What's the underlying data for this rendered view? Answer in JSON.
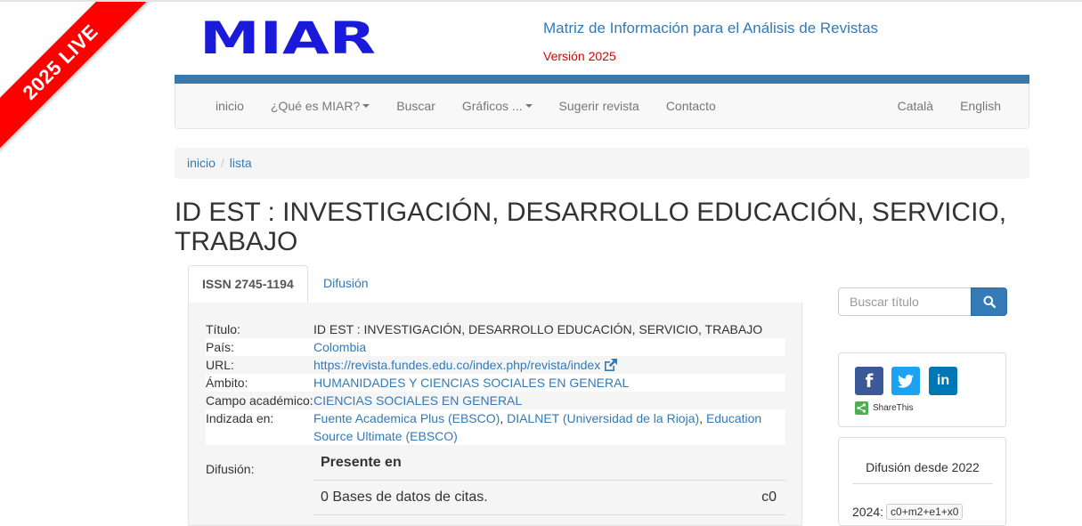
{
  "ribbon": {
    "text": "2025 LIVE"
  },
  "header": {
    "logo_text": "MIAR",
    "title": "Matriz de Información para el Análisis de Revistas",
    "version": "Versión 2025"
  },
  "nav": {
    "left": [
      "inicio",
      "¿Qué es MIAR?",
      "Buscar",
      "Gráficos ...",
      "Sugerir revista",
      "Contacto"
    ],
    "right": [
      "Català",
      "English"
    ]
  },
  "breadcrumb": [
    "inicio",
    "lista"
  ],
  "page_title": "ID EST : INVESTIGACIÓN, DESARROLLO EDUCACIÓN, SERVICIO, TRABAJO",
  "tabs": {
    "active": "ISSN 2745-1194",
    "other": "Difusión"
  },
  "details": {
    "titulo_label": "Título:",
    "titulo_value": "ID EST : INVESTIGACIÓN, DESARROLLO EDUCACIÓN, SERVICIO, TRABAJO",
    "pais_label": "País:",
    "pais_value": "Colombia",
    "url_label": "URL:",
    "url_value": "https://revista.fundes.edu.co/index.php/revista/index",
    "ambito_label": "Ámbito:",
    "ambito_value": "HUMANIDADES Y CIENCIAS SOCIALES EN GENERAL",
    "campo_label": "Campo académico:",
    "campo_value": "CIENCIAS SOCIALES EN GENERAL",
    "indizada_label": "Indizada en:",
    "indizada_values": [
      "Fuente Academica Plus (EBSCO)",
      "DIALNET (Universidad de la Rioja)",
      "Education Source Ultimate (EBSCO)"
    ],
    "difusion_label": "Difusión:",
    "presente_en": "Presente en",
    "citas_text": "0 Bases de datos de citas.",
    "citas_value": "c0"
  },
  "sidebar": {
    "search_placeholder": "Buscar título",
    "share_label": "ShareThis",
    "difusion_title": "Difusión desde 2022",
    "year_label": "2024:",
    "year_formula": "c0+m2+e1+x0"
  },
  "colors": {
    "brand_blue": "#1a1adb",
    "link": "#337ab7",
    "ribbon": "#ff0000",
    "version": "#e00000",
    "topbar": "#3a79ab"
  }
}
